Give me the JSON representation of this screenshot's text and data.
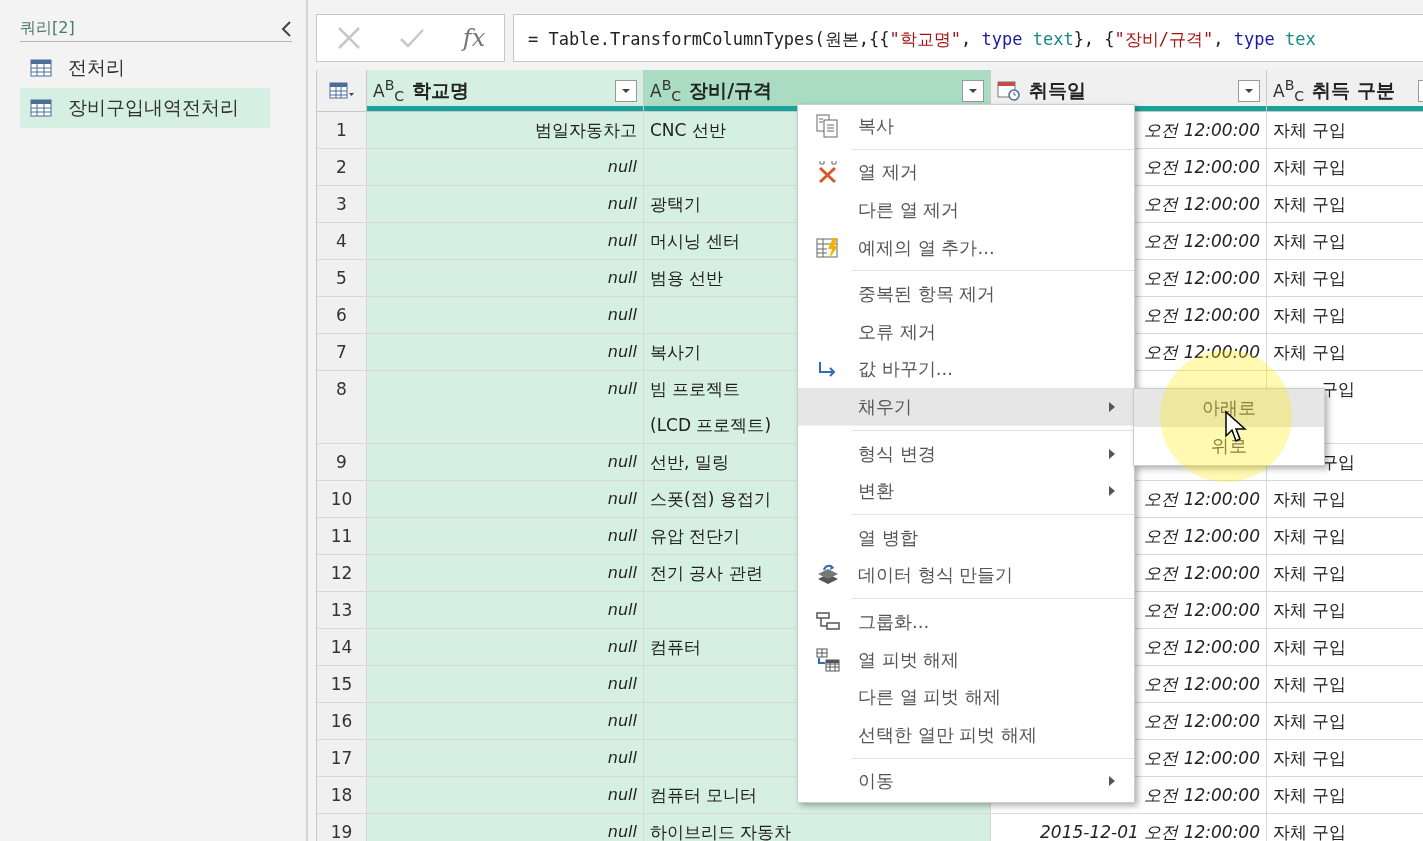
{
  "sidebar": {
    "title": "쿼리[2]",
    "items": [
      {
        "label": "전처리",
        "selected": false
      },
      {
        "label": "장비구입내역전처리",
        "selected": true
      }
    ]
  },
  "formula_bar": {
    "fx": "fx",
    "segments": [
      {
        "kind": "plain",
        "text": "= Table.TransformColumnTypes(원본,{{"
      },
      {
        "kind": "string",
        "text": "\"학교명\""
      },
      {
        "kind": "plain",
        "text": ", "
      },
      {
        "kind": "keyword",
        "text": "type"
      },
      {
        "kind": "type",
        "text": " text"
      },
      {
        "kind": "plain",
        "text": "}, {"
      },
      {
        "kind": "string",
        "text": "\"장비/규격\""
      },
      {
        "kind": "plain",
        "text": ", "
      },
      {
        "kind": "keyword",
        "text": "type"
      },
      {
        "kind": "type",
        "text": " tex"
      }
    ]
  },
  "table": {
    "columns": [
      {
        "name": "학교명",
        "kind": "text",
        "type_label": "A$^{B}$$_{C}$",
        "selected": true,
        "focused": false
      },
      {
        "name": "장비/규격",
        "kind": "text",
        "type_label": "A$^{B}$$_{C}$",
        "selected": true,
        "focused": true
      },
      {
        "name": "취득일",
        "kind": "date",
        "selected": false,
        "focused": false
      },
      {
        "name": "취득 구분",
        "kind": "text",
        "type_label": "A$^{B}$$_{C}$",
        "selected": false,
        "focused": false
      }
    ],
    "rows": [
      {
        "n": "1",
        "school": "범일자동차고",
        "school_null": false,
        "equipment": "CNC 선반",
        "date": "오전 12:00:00",
        "acquisition": "자체 구입",
        "acq_partial": false
      },
      {
        "n": "2",
        "school": "null",
        "school_null": true,
        "date": "오전 12:00:00",
        "acquisition": "자체 구입",
        "acq_partial": false
      },
      {
        "n": "3",
        "school": "null",
        "school_null": true,
        "equipment": "광택기",
        "date": "오전 12:00:00",
        "acquisition": "자체 구입",
        "acq_partial": false
      },
      {
        "n": "4",
        "school": "null",
        "school_null": true,
        "equipment": "머시닝 센터",
        "date": "오전 12:00:00",
        "acquisition": "자체 구입",
        "acq_partial": false
      },
      {
        "n": "5",
        "school": "null",
        "school_null": true,
        "equipment": "범용 선반",
        "date": "오전 12:00:00",
        "acquisition": "자체 구입",
        "acq_partial": false
      },
      {
        "n": "6",
        "school": "null",
        "school_null": true,
        "date": "오전 12:00:00",
        "acquisition": "자체 구입",
        "acq_partial": false
      },
      {
        "n": "7",
        "school": "null",
        "school_null": true,
        "equipment": "복사기",
        "date": "오전 12:00:00",
        "acquisition": "자체 구입",
        "acq_partial": false
      },
      {
        "n": "8",
        "school": "null",
        "school_null": true,
        "equipment": "빔 프로젝트\n(LCD 프로젝트)",
        "acquisition": "구입",
        "acq_partial": true
      },
      {
        "n": "9",
        "school": "null",
        "school_null": true,
        "equipment": "선반, 밀링",
        "acquisition": "구입",
        "acq_partial": true
      },
      {
        "n": "10",
        "school": "null",
        "school_null": true,
        "equipment": "스폿(점) 용접기",
        "date": "오전 12:00:00",
        "acquisition": "자체 구입",
        "acq_partial": false
      },
      {
        "n": "11",
        "school": "null",
        "school_null": true,
        "equipment": "유압 전단기",
        "date": "오전 12:00:00",
        "acquisition": "자체 구입",
        "acq_partial": false
      },
      {
        "n": "12",
        "school": "null",
        "school_null": true,
        "equipment": "전기 공사 관련",
        "date": "오전 12:00:00",
        "acquisition": "자체 구입",
        "acq_partial": false
      },
      {
        "n": "13",
        "school": "null",
        "school_null": true,
        "date": "오전 12:00:00",
        "acquisition": "자체 구입",
        "acq_partial": false
      },
      {
        "n": "14",
        "school": "null",
        "school_null": true,
        "equipment": "컴퓨터",
        "date": "오전 12:00:00",
        "acquisition": "자체 구입",
        "acq_partial": false
      },
      {
        "n": "15",
        "school": "null",
        "school_null": true,
        "date": "오전 12:00:00",
        "acquisition": "자체 구입",
        "acq_partial": false
      },
      {
        "n": "16",
        "school": "null",
        "school_null": true,
        "date": "오전 12:00:00",
        "acquisition": "자체 구입",
        "acq_partial": false
      },
      {
        "n": "17",
        "school": "null",
        "school_null": true,
        "date": "오전 12:00:00",
        "acquisition": "자체 구입",
        "acq_partial": false
      },
      {
        "n": "18",
        "school": "null",
        "school_null": true,
        "equipment": "컴퓨터 모니터",
        "date": "오전 12:00:00",
        "acquisition": "자체 구입",
        "acq_partial": false
      },
      {
        "n": "19",
        "school": "null",
        "school_null": true,
        "equipment": "하이브리드 자동차",
        "date": "2015-12-01 오전 12:00:00",
        "acquisition": "자체 구입",
        "acq_partial": false
      }
    ]
  },
  "context_menu": {
    "items": [
      {
        "label": "복사",
        "kind": "copy",
        "submenu": false,
        "selected": false,
        "group_end": true
      },
      {
        "label": "열 제거",
        "kind": "remove",
        "submenu": false,
        "selected": false,
        "group_end": false
      },
      {
        "label": "다른 열 제거",
        "kind": "plain",
        "submenu": false,
        "selected": false,
        "group_end": false
      },
      {
        "label": "예제의 열 추가...",
        "kind": "example",
        "submenu": false,
        "selected": false,
        "group_end": true
      },
      {
        "label": "중복된 항목 제거",
        "kind": "plain",
        "submenu": false,
        "selected": false,
        "group_end": false
      },
      {
        "label": "오류 제거",
        "kind": "plain",
        "submenu": false,
        "selected": false,
        "group_end": false
      },
      {
        "label": "값 바꾸기...",
        "kind": "replace",
        "submenu": false,
        "selected": false,
        "group_end": false
      },
      {
        "label": "채우기",
        "kind": "plain",
        "submenu": true,
        "selected": true,
        "group_end": true
      },
      {
        "label": "형식 변경",
        "kind": "plain",
        "submenu": true,
        "selected": false,
        "group_end": false
      },
      {
        "label": "변환",
        "kind": "plain",
        "submenu": true,
        "selected": false,
        "group_end": true
      },
      {
        "label": "열 병합",
        "kind": "plain",
        "submenu": false,
        "selected": false,
        "group_end": false
      },
      {
        "label": "데이터 형식 만들기",
        "kind": "datatype",
        "submenu": false,
        "selected": false,
        "group_end": true
      },
      {
        "label": "그룹화...",
        "kind": "group",
        "submenu": false,
        "selected": false,
        "group_end": false
      },
      {
        "label": "열 피벗 해제",
        "kind": "unpivot",
        "submenu": false,
        "selected": false,
        "group_end": false
      },
      {
        "label": "다른 열 피벗 해제",
        "kind": "plain",
        "submenu": false,
        "selected": false,
        "group_end": false
      },
      {
        "label": "선택한 열만 피벗 해제",
        "kind": "plain",
        "submenu": false,
        "selected": false,
        "group_end": true
      },
      {
        "label": "이동",
        "kind": "plain",
        "submenu": true,
        "selected": false,
        "group_end": false
      }
    ]
  },
  "submenu": {
    "items": [
      {
        "label": "아래로",
        "selected": true
      },
      {
        "label": "위로",
        "selected": false
      }
    ]
  }
}
